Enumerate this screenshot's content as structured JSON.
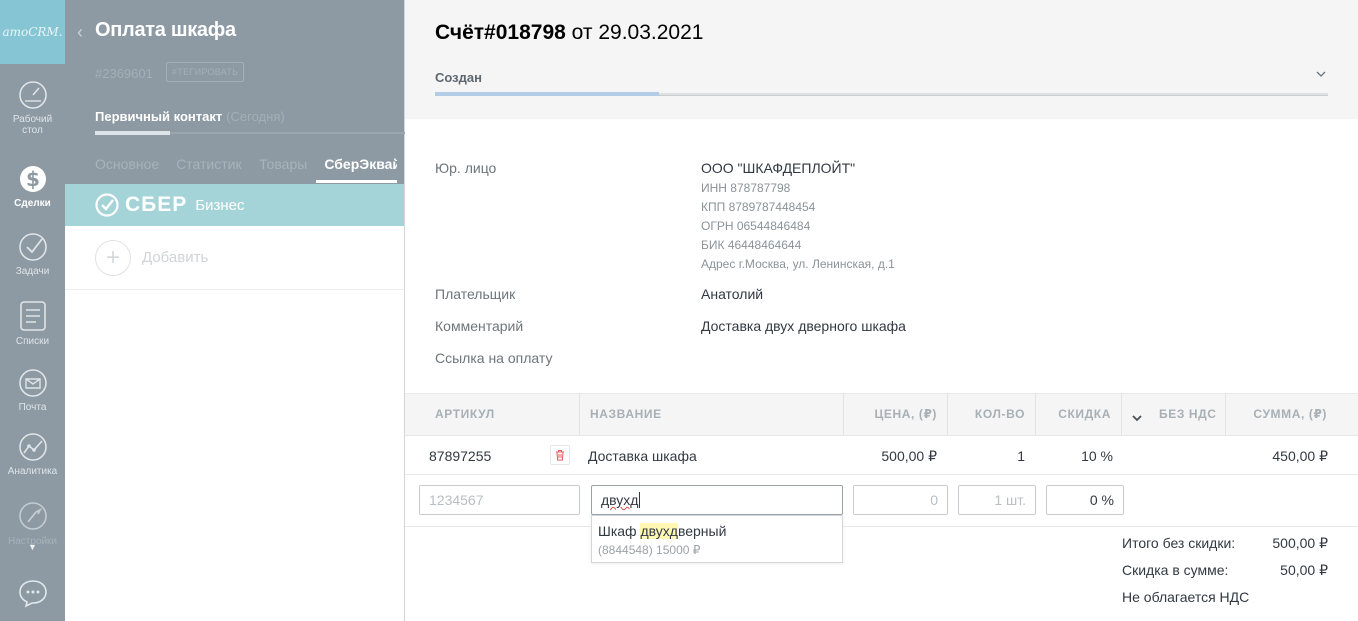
{
  "app": {
    "logo": "amoCRM."
  },
  "rail": {
    "items": [
      {
        "label": "Рабочий стол",
        "icon": "dashboard-icon"
      },
      {
        "label": "Сделки",
        "icon": "dollar-icon",
        "active": true
      },
      {
        "label": "Задачи",
        "icon": "task-check-icon"
      },
      {
        "label": "Списки",
        "icon": "lists-icon"
      },
      {
        "label": "Почта",
        "icon": "mail-icon"
      },
      {
        "label": "Аналитика",
        "icon": "analytics-icon"
      },
      {
        "label": "Настройки",
        "icon": "settings-wrench-icon"
      }
    ]
  },
  "lead": {
    "title": "Оплата шкафа",
    "id": "#2369601",
    "tag_button": "#ТЕГИРОВАТЬ",
    "stage": "Первичный контакт",
    "stage_date": "(Сегодня)",
    "tabs": [
      "Основное",
      "Статистика",
      "Товары",
      "СберЭквай"
    ],
    "widget": {
      "brand": "СБЕР",
      "sub": "Бизнес"
    },
    "add_label": "Добавить"
  },
  "invoice": {
    "title_number": "Счёт#018798",
    "title_from": "от",
    "title_date": "29.03.2021",
    "status": "Создан",
    "legal_label": "Юр. лицо",
    "legal_name": "ООО \"ШКАФДЕПЛОЙТ\"",
    "requisites": {
      "inn": "ИНН 878787798",
      "kpp": "КПП 8789787448454",
      "ogrn": "ОГРН 06544846484",
      "bik": "БИК 46448464644",
      "address": "Адрес г.Москва, ул. Ленинская, д.1"
    },
    "payer_label": "Плательщик",
    "payer": "Анатолий",
    "comment_label": "Комментарий",
    "comment": "Доставка двух дверного шкафа",
    "pay_link_label": "Ссылка на оплату"
  },
  "table": {
    "headers": {
      "sku": "АРТИКУЛ",
      "name": "НАЗВАНИЕ",
      "price": "ЦЕНА, (₽)",
      "qty": "КОЛ-ВО",
      "discount": "СКИДКА",
      "vat": "БЕЗ НДС",
      "sum": "СУММА, (₽)"
    },
    "rows": [
      {
        "sku": "87897255",
        "name": "Доставка шкафа",
        "price": "500,00 ₽",
        "qty": "1",
        "discount": "10 %",
        "sum": "450,00 ₽"
      }
    ],
    "new_row": {
      "sku_placeholder": "1234567",
      "name_value": "двухд",
      "price_placeholder": "0",
      "qty_placeholder": "1 шт.",
      "discount_value": "0 %"
    }
  },
  "suggestion": {
    "name_before": "Шкаф ",
    "name_match": "двухд",
    "name_after": "верный",
    "sub": "(8844548) 15000 ₽"
  },
  "totals": {
    "no_discount_label": "Итого без скидки:",
    "no_discount_value": "500,00 ₽",
    "discount_label": "Скидка в сумме:",
    "discount_value": "50,00 ₽",
    "vat_label": "Не облагается НДС"
  }
}
